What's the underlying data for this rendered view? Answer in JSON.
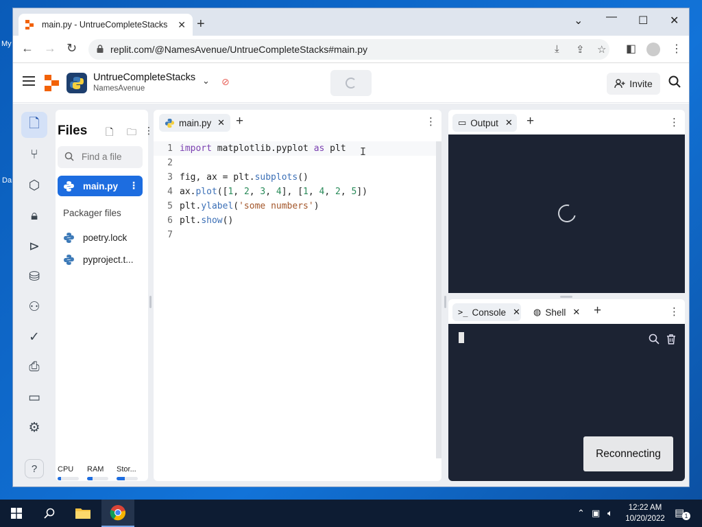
{
  "desktop": {
    "label_a": "My",
    "label_b": "Da"
  },
  "browser": {
    "tab_title": "main.py - UntrueCompleteStacks",
    "url": "replit.com/@NamesAvenue/UntrueCompleteStacks#main.py"
  },
  "header": {
    "project_name": "UntrueCompleteStacks",
    "owner": "NamesAvenue",
    "invite_label": "Invite"
  },
  "files": {
    "title": "Files",
    "search_placeholder": "Find a file",
    "items": [
      {
        "name": "main.py",
        "selected": true
      },
      {
        "name": "poetry.lock"
      },
      {
        "name": "pyproject.t..."
      }
    ],
    "packager_label": "Packager files",
    "resources": [
      {
        "label": "CPU",
        "fill": 0.15
      },
      {
        "label": "RAM",
        "fill": 0.25
      },
      {
        "label": "Stor...",
        "fill": 0.4
      }
    ]
  },
  "editor": {
    "tab_label": "main.py",
    "code": [
      {
        "n": "1",
        "text": "import matplotlib.pyplot as plt"
      },
      {
        "n": "2",
        "text": ""
      },
      {
        "n": "3",
        "text": "fig, ax = plt.subplots()"
      },
      {
        "n": "4",
        "text": "ax.plot([1, 2, 3, 4], [1, 4, 2, 5])"
      },
      {
        "n": "5",
        "text": "plt.ylabel('some numbers')"
      },
      {
        "n": "6",
        "text": "plt.show()"
      },
      {
        "n": "7",
        "text": ""
      }
    ]
  },
  "output": {
    "tab_label": "Output"
  },
  "console": {
    "console_tab": "Console",
    "shell_tab": "Shell",
    "reconnecting_label": "Reconnecting"
  },
  "taskbar": {
    "time": "12:22 AM",
    "date": "10/20/2022",
    "notifications": "1"
  },
  "colors": {
    "accent": "#1d6de0",
    "replit_orange": "#f26207",
    "dark_panel": "#1c2333"
  }
}
